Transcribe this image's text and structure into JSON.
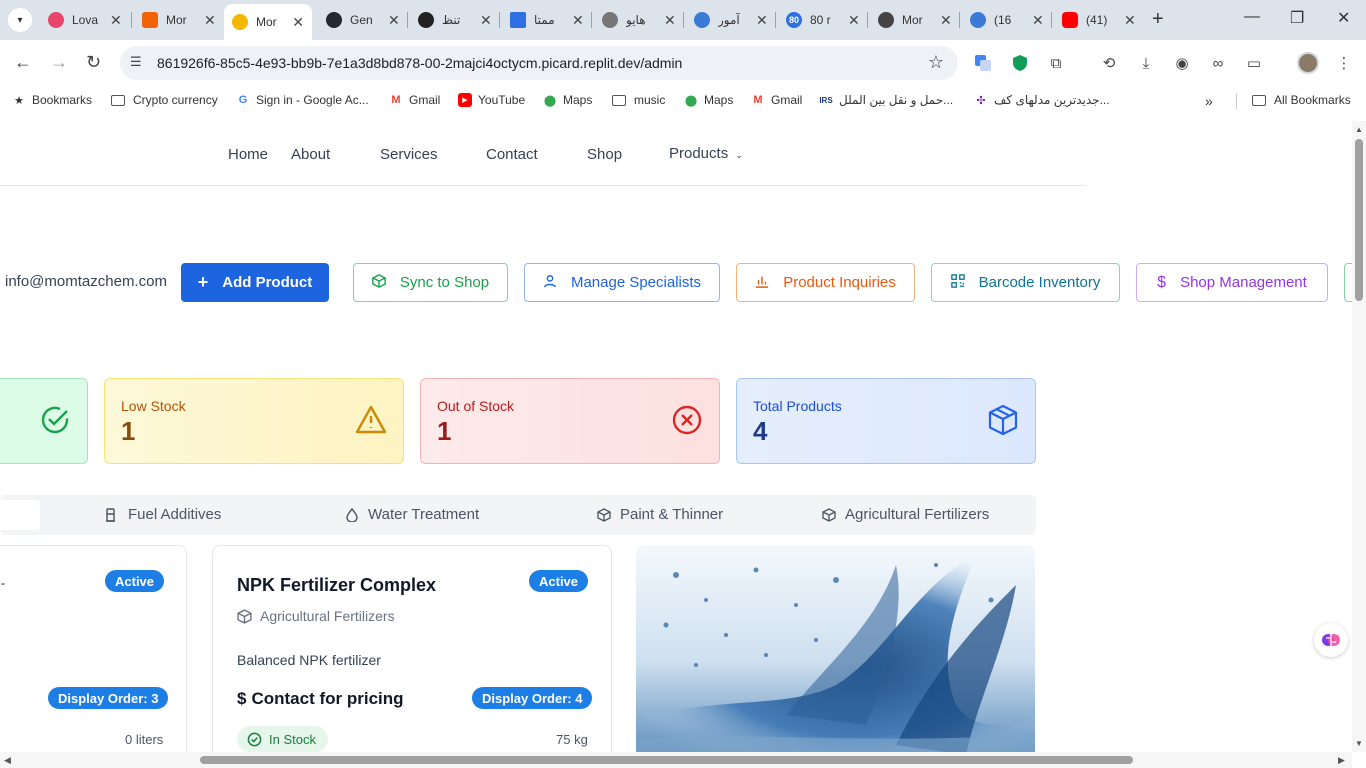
{
  "browser": {
    "tabs": [
      {
        "title": "Lova",
        "favicon": "heart-icon",
        "color": "#e8456d"
      },
      {
        "title": "Mor",
        "favicon": "replit-icon",
        "color": "#f26207"
      },
      {
        "title": "Mor",
        "favicon": "replit-icon",
        "color": "#f5b700",
        "active": true
      },
      {
        "title": "Gen",
        "favicon": "github-icon",
        "color": "#24292f"
      },
      {
        "title": "تنظ",
        "favicon": "chatgpt-icon",
        "color": "#222222"
      },
      {
        "title": "ممتا",
        "favicon": "docs-icon",
        "color": "#2f6fe4"
      },
      {
        "title": "هایو",
        "favicon": "globe-icon",
        "color": "#666666"
      },
      {
        "title": "آمور",
        "favicon": "play-icon",
        "color": "#3b7bd6"
      },
      {
        "title": "80 r",
        "favicon": "badge-icon",
        "color": "#2f6fe4"
      },
      {
        "title": "Mor",
        "favicon": "globe-icon",
        "color": "#444444"
      },
      {
        "title": "(16",
        "favicon": "globe-icon",
        "color": "#3b7bd6"
      },
      {
        "title": "(41)",
        "favicon": "youtube-icon",
        "color": "#ff0000"
      }
    ],
    "url": "861926f6-85c5-4e93-bb9b-7e1a3d8bd878-00-2majci4octycm.picard.replit.dev/admin",
    "bookmarks": [
      {
        "label": "Bookmarks",
        "icon": "star-icon"
      },
      {
        "label": "Crypto currency",
        "icon": "folder-icon"
      },
      {
        "label": "Sign in - Google Ac...",
        "icon": "google-icon"
      },
      {
        "label": "Gmail",
        "icon": "gmail-icon"
      },
      {
        "label": "YouTube",
        "icon": "youtube-icon"
      },
      {
        "label": "Maps",
        "icon": "maps-icon"
      },
      {
        "label": "music",
        "icon": "folder-icon"
      },
      {
        "label": "Maps",
        "icon": "maps-icon"
      },
      {
        "label": "Gmail",
        "icon": "gmail-icon"
      },
      {
        "label": "حمل و نقل بین الملل...",
        "icon": "site-icon"
      },
      {
        "label": "جدیدترین مدلهای کف...",
        "icon": "site-icon"
      }
    ],
    "all_bookmarks": "All Bookmarks"
  },
  "nav": {
    "items": [
      "Home",
      "About",
      "Services",
      "Contact",
      "Shop"
    ],
    "products": "Products"
  },
  "admin": {
    "email": "info@momtazchem.com",
    "actions": [
      {
        "label": "Add Product",
        "icon": "plus-icon",
        "color": "#1d64e0"
      },
      {
        "label": "Sync to Shop",
        "icon": "box-icon",
        "color": "#16a34a"
      },
      {
        "label": "Manage Specialists",
        "icon": "user-icon",
        "color": "#1d64e0"
      },
      {
        "label": "Product Inquiries",
        "icon": "bar-chart-icon",
        "color": "#ea580c"
      },
      {
        "label": "Barcode Inventory",
        "icon": "qr-icon",
        "color": "#0e7490"
      },
      {
        "label": "Shop Management",
        "icon": "dollar-icon",
        "color": "#9333ea"
      }
    ]
  },
  "stats": [
    {
      "label": "Low Stock",
      "value": "1",
      "icon": "warning-icon"
    },
    {
      "label": "Out of Stock",
      "value": "1",
      "icon": "x-circle-icon"
    },
    {
      "label": "Total Products",
      "value": "4",
      "icon": "package-icon"
    }
  ],
  "categories": [
    {
      "label": "Fuel Additives",
      "icon": "fuel-icon"
    },
    {
      "label": "Water Treatment",
      "icon": "droplet-icon"
    },
    {
      "label": "Paint & Thinner",
      "icon": "package-icon"
    },
    {
      "label": "Agricultural Fertilizers",
      "icon": "package-icon"
    }
  ],
  "cards": [
    {
      "status": "Active",
      "display_order": "Display Order: 3",
      "quantity": "0 liters"
    },
    {
      "name": "NPK Fertilizer Complex",
      "status": "Active",
      "category": "Agricultural Fertilizers",
      "description": "Balanced NPK fertilizer",
      "price": "Contact for pricing",
      "display_order": "Display Order: 4",
      "stock": "In Stock",
      "quantity": "75 kg"
    }
  ]
}
